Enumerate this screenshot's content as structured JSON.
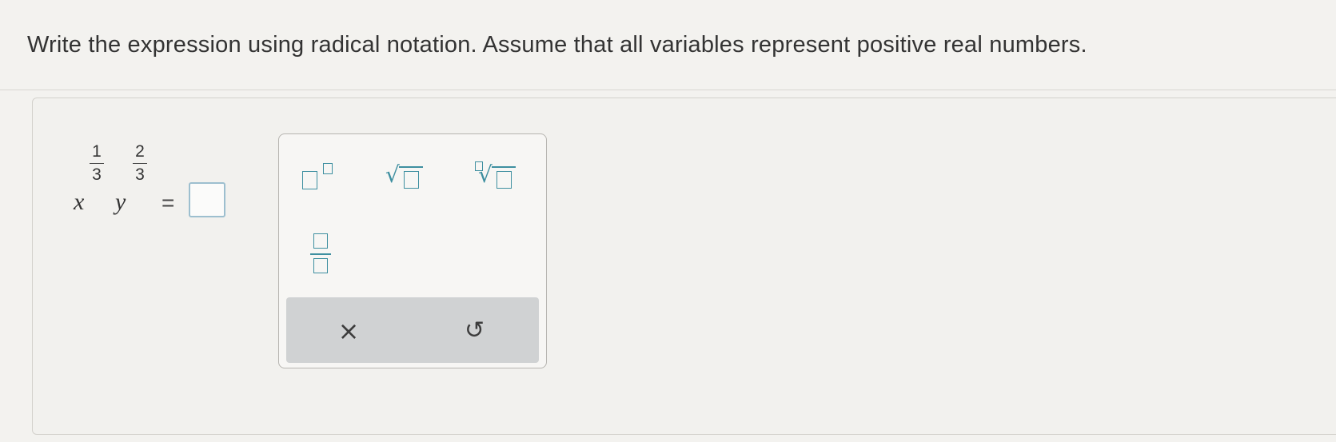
{
  "question": {
    "text": "Write the expression using radical notation. Assume that all variables represent positive real numbers."
  },
  "expression": {
    "var1": "x",
    "exp1_num": "1",
    "exp1_den": "3",
    "var2": "y",
    "exp2_num": "2",
    "exp2_den": "3",
    "equals": "="
  },
  "palette": {
    "tools": [
      "exponent-template",
      "square-root-template",
      "nth-root-template",
      "fraction-template"
    ],
    "actions": {
      "clear_symbol": "×",
      "undo_symbol": "↻"
    }
  },
  "colors": {
    "accent": "#3e8fa0",
    "answer_box_border": "#9dbfcf",
    "action_bar": "#d0d2d3"
  },
  "icons": {
    "clear": "close-icon",
    "undo": "undo-icon"
  }
}
